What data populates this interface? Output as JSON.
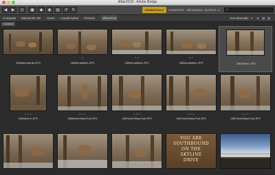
{
  "window": {
    "title": "dfdar2018 - Adobe Bridge"
  },
  "toolbar": {
    "back_icon": "arrow-left-icon",
    "forward_icon": "arrow-right-icon",
    "workspaces": [
      {
        "label": "ESSENTIALS",
        "active": true
      },
      {
        "label": "FILMSTRIP",
        "active": false
      },
      {
        "label": "METADATA",
        "active": false
      },
      {
        "label": "OUTPUT",
        "active": false
      }
    ],
    "search_placeholder": "",
    "accent_color": "#c79d20"
  },
  "pathbar": {
    "crumbs": [
      "Computer",
      "Macintosh HD",
      "Users",
      "LinodeAuthor",
      "Pictures",
      "dfdar2018"
    ],
    "sort_label": "Sort Manually"
  },
  "content": {
    "tab_label": "Content",
    "items": [
      {
        "rating": "",
        "filename": "2665deerfamily.JPG",
        "selected": false
      },
      {
        "rating": "*",
        "filename": "2665smalldeer.JPG",
        "selected": false
      },
      {
        "rating": "* *",
        "filename": "2665smalldeer.JPG",
        "selected": false
      },
      {
        "rating": "* *",
        "filename": "2665smalldeer.JPG",
        "selected": false
      },
      {
        "rating": "",
        "filename": "2662deer1.JPG",
        "selected": true
      },
      {
        "rating": "* * *",
        "filename": "2665deer1.JPG",
        "selected": false
      },
      {
        "rating": "* * *",
        "filename": "2666deerSkieyTrail.JPG",
        "selected": false
      },
      {
        "rating": "* * *",
        "filename": "2667deerSkieyTrail.JPG",
        "selected": false
      },
      {
        "rating": "* * *",
        "filename": "2667deerSkieyTrail.JPG",
        "selected": false
      },
      {
        "rating": "* * *",
        "filename": "2667deerSkieyTrail.JPG",
        "selected": false
      },
      {
        "rating": "",
        "filename": "",
        "selected": false
      },
      {
        "rating": "",
        "filename": "",
        "selected": false
      },
      {
        "rating": "",
        "filename": "",
        "selected": false
      },
      {
        "rating": "",
        "filename": "",
        "selected": false
      },
      {
        "rating": "",
        "filename": "",
        "selected": false
      }
    ],
    "sign_lines": [
      "YOU ARE",
      "SOUTHBOUND",
      "ON THE",
      "SKYLINE",
      "DRIVE"
    ]
  }
}
